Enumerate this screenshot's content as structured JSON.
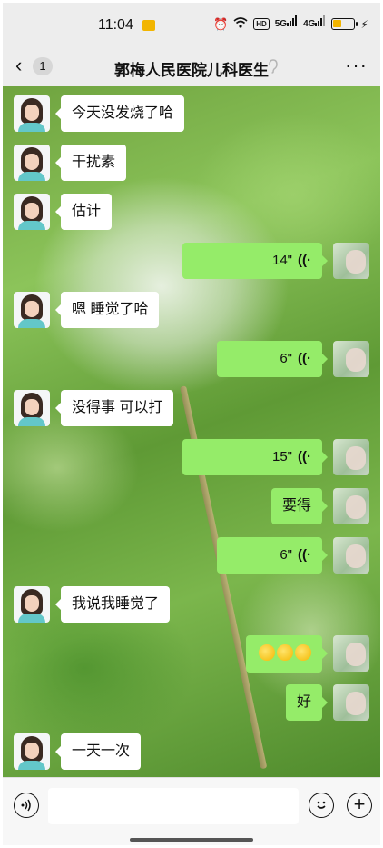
{
  "status_bar": {
    "time": "11:04",
    "icons": [
      "alarm-icon",
      "wifi-icon",
      "hd-icon",
      "5g-signal-icon",
      "4g-signal-icon",
      "battery-icon",
      "charging-icon"
    ],
    "hd_label": "HD",
    "net1_label": "5G",
    "net2_label": "4G",
    "battery_level": 0.45
  },
  "header": {
    "back_icon": "chevron-left-icon",
    "unread_count": "1",
    "title": "郭梅人民医院儿科医生",
    "mute_icon": "ear-icon",
    "more_icon": "more-icon",
    "more_label": "···"
  },
  "colors": {
    "self_bubble": "#95ec69",
    "other_bubble": "#ffffff",
    "bar_bg": "#ededed"
  },
  "messages": [
    {
      "side": "left",
      "type": "text",
      "text": "今天没发烧了哈"
    },
    {
      "side": "left",
      "type": "text",
      "text": "干扰素"
    },
    {
      "side": "left",
      "type": "text",
      "text": "估计"
    },
    {
      "side": "right",
      "type": "voice",
      "duration": "14\""
    },
    {
      "side": "left",
      "type": "text",
      "text": "嗯 睡觉了哈"
    },
    {
      "side": "right",
      "type": "voice",
      "duration": "6\""
    },
    {
      "side": "left",
      "type": "text",
      "text": "没得事 可以打"
    },
    {
      "side": "right",
      "type": "voice",
      "duration": "15\""
    },
    {
      "side": "right",
      "type": "text",
      "text": "要得"
    },
    {
      "side": "right",
      "type": "voice",
      "duration": "6\""
    },
    {
      "side": "left",
      "type": "text",
      "text": "我说我睡觉了"
    },
    {
      "side": "right",
      "type": "emoji",
      "emoji_icon": "rofl-emoji-icon",
      "count": 3
    },
    {
      "side": "right",
      "type": "text",
      "text": "好"
    },
    {
      "side": "left",
      "type": "text",
      "text": "一天一次"
    }
  ],
  "voice_wave_glyph": "((·",
  "input_bar": {
    "voice_toggle_icon": "voice-toggle-icon",
    "text_value": "",
    "emoji_icon": "smiley-icon",
    "plus_icon": "plus-icon"
  }
}
